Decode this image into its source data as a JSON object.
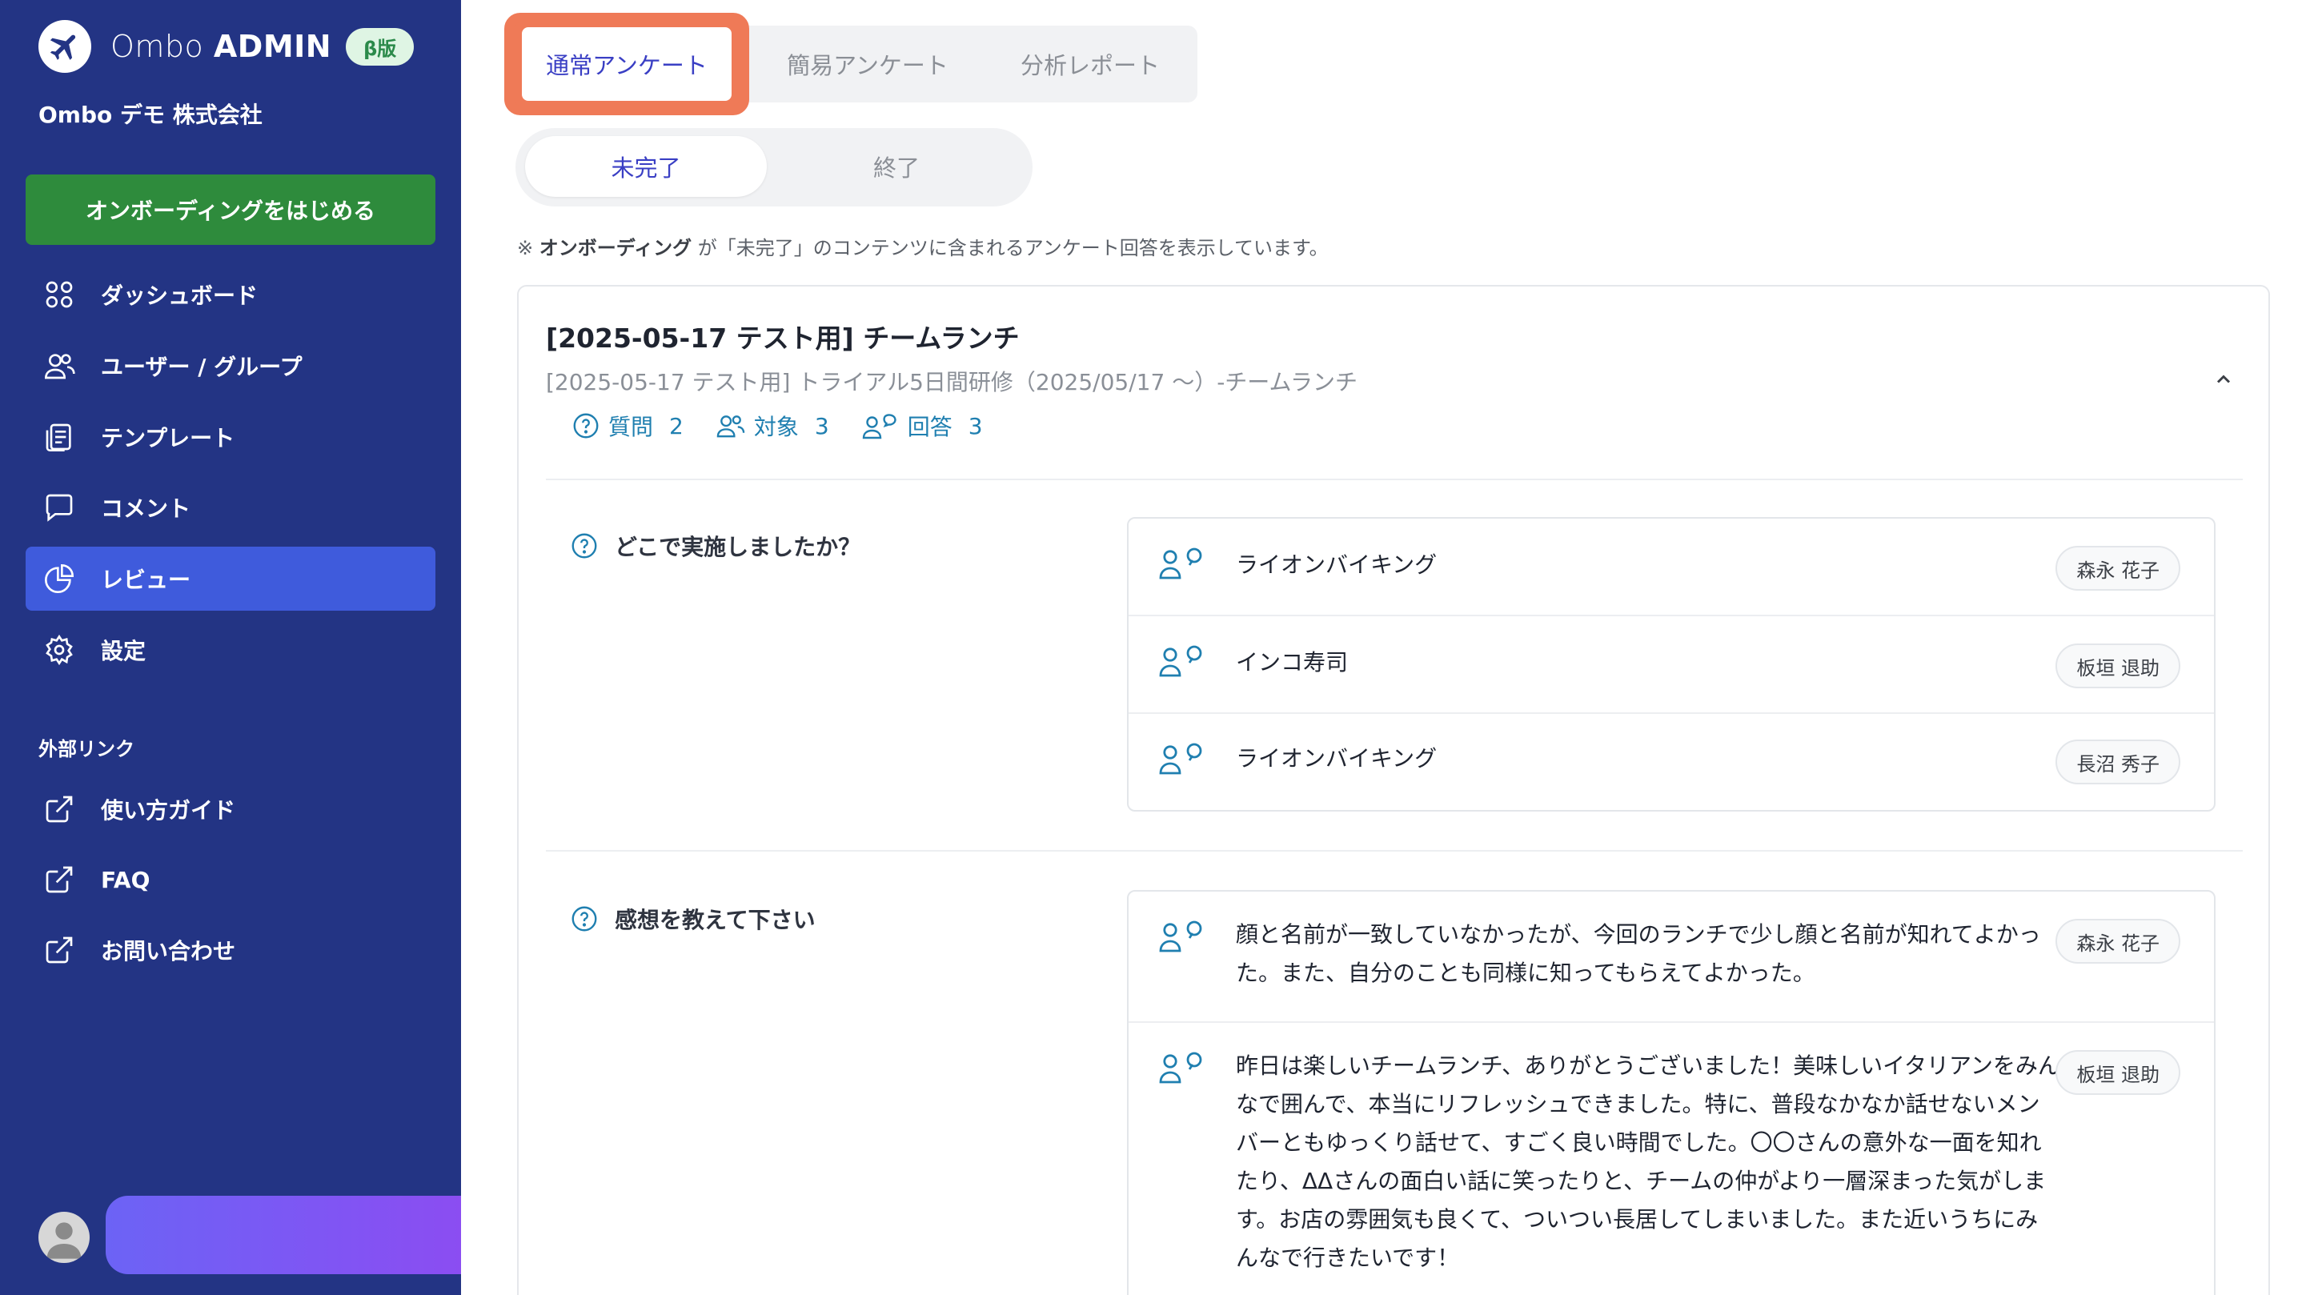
{
  "sidebar": {
    "brand": {
      "name_light": "Ombo ",
      "name_bold": "ADMIN",
      "badge": "β版"
    },
    "company": "Ombo デモ 株式会社",
    "onboarding_button": "オンボーディングをはじめる",
    "nav": [
      {
        "label": "ダッシュボード",
        "icon": "dashboard-icon"
      },
      {
        "label": "ユーザー / グループ",
        "icon": "users-icon"
      },
      {
        "label": "テンプレート",
        "icon": "clipboard-icon"
      },
      {
        "label": "コメント",
        "icon": "comment-icon"
      },
      {
        "label": "レビュー",
        "icon": "pie-chart-icon",
        "active": true
      },
      {
        "label": "設定",
        "icon": "gear-icon"
      }
    ],
    "external_section": "外部リンク",
    "external_links": [
      {
        "label": "使い方ガイド",
        "icon": "external-link-icon"
      },
      {
        "label": "FAQ",
        "icon": "external-link-icon"
      },
      {
        "label": "お問い合わせ",
        "icon": "external-link-icon"
      }
    ]
  },
  "tabs": [
    {
      "label": "通常アンケート",
      "active": true
    },
    {
      "label": "簡易アンケート"
    },
    {
      "label": "分析レポート"
    }
  ],
  "sub_tabs": [
    {
      "label": "未完了",
      "active": true
    },
    {
      "label": "終了"
    }
  ],
  "notice": {
    "prefix": "※ ",
    "bold": "オンボーディング",
    "rest": " が「未完了」のコンテンツに含まれるアンケート回答を表示しています。"
  },
  "survey": {
    "title": "[2025-05-17 テスト用] チームランチ",
    "subtitle": "[2025-05-17 テスト用] トライアル5日間研修（2025/05/17 〜）-チームランチ",
    "stats": {
      "questions_label": "質問",
      "questions_count": "2",
      "targets_label": "対象",
      "targets_count": "3",
      "answers_label": "回答",
      "answers_count": "3"
    },
    "questions": [
      {
        "text": "どこで実施しましたか？",
        "answers": [
          {
            "text": "ライオンバイキング",
            "respondent": "森永 花子"
          },
          {
            "text": "インコ寿司",
            "respondent": "板垣 退助"
          },
          {
            "text": "ライオンバイキング",
            "respondent": "長沼 秀子"
          }
        ]
      },
      {
        "text": "感想を教えて下さい",
        "answers": [
          {
            "text": "顔と名前が一致していなかったが、今回のランチで少し顔と名前が知れてよかった。また、自分のことも同様に知ってもらえてよかった。",
            "respondent": "森永 花子"
          },
          {
            "text": "昨日は楽しいチームランチ、ありがとうございました！美味しいイタリアンをみんなで囲んで、本当にリフレッシュできました。特に、普段なかなか話せないメンバーともゆっくり話せて、すごく良い時間でした。〇〇さんの意外な一面を知れたり、ΔΔさんの面白い話に笑ったりと、チームの仲がより一層深まった気がします。お店の雰囲気も良くて、ついつい長居してしまいました。また近いうちにみんなで行きたいです！",
            "respondent": "板垣 退助"
          }
        ]
      }
    ]
  },
  "colors": {
    "sidebar": "#233484",
    "active_nav": "#3f5bdc",
    "onboarding": "#2e8b3c",
    "accent": "#3a3fc4",
    "highlight": "#ef7a57"
  }
}
